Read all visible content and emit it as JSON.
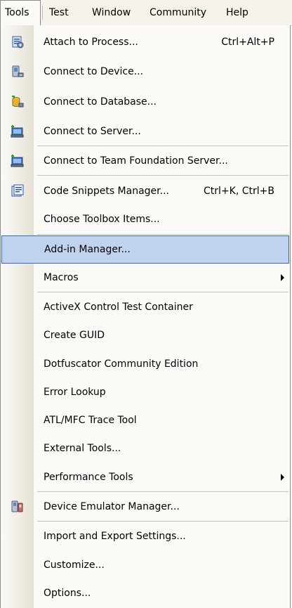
{
  "menubar": {
    "items": [
      {
        "label": "Tools",
        "active": true
      },
      {
        "label": "Test"
      },
      {
        "label": "Window"
      },
      {
        "label": "Community"
      },
      {
        "label": "Help"
      }
    ]
  },
  "menu": {
    "items": [
      {
        "label": "Attach to Process...",
        "shortcut": "Ctrl+Alt+P",
        "icon": "attach-process-icon"
      },
      {
        "label": "Connect to Device...",
        "icon": "connect-device-icon"
      },
      {
        "label": "Connect to Database...",
        "icon": "connect-database-icon"
      },
      {
        "label": "Connect to Server...",
        "icon": "connect-server-icon"
      },
      {
        "label": "Connect to Team Foundation Server...",
        "icon": "connect-tfs-icon"
      },
      {
        "label": "Code Snippets Manager...",
        "shortcut": "Ctrl+K, Ctrl+B",
        "icon": "code-snippets-icon"
      },
      {
        "label": "Choose Toolbox Items..."
      },
      {
        "label": "Add-in Manager...",
        "highlighted": true
      },
      {
        "label": "Macros",
        "submenu": true
      },
      {
        "label": "ActiveX Control Test Container"
      },
      {
        "label": "Create GUID"
      },
      {
        "label": "Dotfuscator Community Edition"
      },
      {
        "label": "Error Lookup"
      },
      {
        "label": "ATL/MFC Trace Tool"
      },
      {
        "label": "External Tools..."
      },
      {
        "label": "Performance Tools",
        "submenu": true
      },
      {
        "label": "Device Emulator Manager...",
        "icon": "device-emulator-icon"
      },
      {
        "label": "Import and Export Settings..."
      },
      {
        "label": "Customize..."
      },
      {
        "label": "Options..."
      }
    ]
  },
  "colors": {
    "highlight_bg": "#c1d2ee",
    "highlight_border": "#316ac5"
  }
}
